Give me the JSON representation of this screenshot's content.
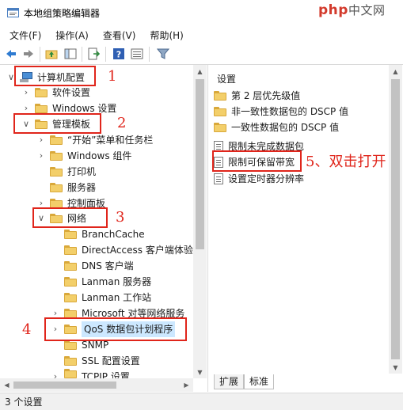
{
  "window": {
    "title": "本地组策略编辑器"
  },
  "watermark": {
    "brand": "php",
    "suffix": "中文网"
  },
  "menu": [
    "文件(F)",
    "操作(A)",
    "查看(V)",
    "帮助(H)"
  ],
  "tree": {
    "items": [
      {
        "label": "计算机配置",
        "chevron": "∨"
      },
      {
        "label": "软件设置",
        "chevron": "›"
      },
      {
        "label": "Windows 设置",
        "chevron": "›"
      },
      {
        "label": "管理模板",
        "chevron": "∨"
      },
      {
        "label": "“开始”菜单和任务栏",
        "chevron": "›"
      },
      {
        "label": "Windows 组件",
        "chevron": "›"
      },
      {
        "label": "打印机",
        "chevron": ""
      },
      {
        "label": "服务器",
        "chevron": ""
      },
      {
        "label": "控制面板",
        "chevron": "›"
      },
      {
        "label": "网络",
        "chevron": "∨"
      },
      {
        "label": "BranchCache",
        "chevron": ""
      },
      {
        "label": "DirectAccess 客户端体验设",
        "chevron": ""
      },
      {
        "label": "DNS 客户端",
        "chevron": ""
      },
      {
        "label": "Lanman 服务器",
        "chevron": ""
      },
      {
        "label": "Lanman 工作站",
        "chevron": ""
      },
      {
        "label": "Microsoft 对等网络服务",
        "chevron": "›"
      },
      {
        "label": "QoS 数据包计划程序",
        "chevron": "›"
      },
      {
        "label": "SNMP",
        "chevron": ""
      },
      {
        "label": "SSL 配置设置",
        "chevron": ""
      },
      {
        "label": "TCPIP 设置",
        "chevron": "›"
      }
    ]
  },
  "right": {
    "header": "设置",
    "items": [
      {
        "label": "第 2 层优先级值",
        "kind": "folder"
      },
      {
        "label": "非一致性数据包的 DSCP 值",
        "kind": "folder"
      },
      {
        "label": "一致性数据包的 DSCP 值",
        "kind": "folder"
      },
      {
        "label": "限制未完成数据包",
        "kind": "setting"
      },
      {
        "label": "限制可保留带宽",
        "kind": "setting"
      },
      {
        "label": "设置定时器分辨率",
        "kind": "setting"
      }
    ]
  },
  "tabs": [
    "扩展",
    "标准"
  ],
  "status": {
    "text": "3 个设置"
  },
  "annotations": {
    "n1": "1",
    "n2": "2",
    "n3": "3",
    "n4": "4",
    "n5": "5、双击打开"
  },
  "colors": {
    "annotation": "#e0251b",
    "folder": "#f3cf6a",
    "selection": "#cce8ff"
  }
}
